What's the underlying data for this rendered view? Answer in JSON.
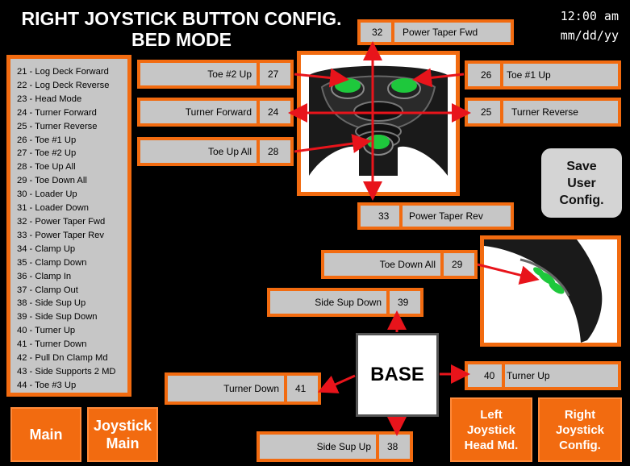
{
  "header": {
    "title_line1": "RIGHT JOYSTICK BUTTON CONFIG.",
    "title_line2": "BED MODE",
    "time": "12:00 am",
    "date": "mm/dd/yy"
  },
  "legend": [
    "21 - Log Deck Forward",
    "22 - Log Deck Reverse",
    "23 - Head Mode",
    "24 - Turner Forward",
    "25 - Turner Reverse",
    "26 - Toe #1 Up",
    "27 - Toe #2 Up",
    "28 - Toe Up All",
    "29 - Toe Down All",
    "30 - Loader Up",
    "31 - Loader Down",
    "32 - Power Taper Fwd",
    "33 - Power Taper Rev",
    "34 - Clamp Up",
    "35 - Clamp Down",
    "36 - Clamp In",
    "37 - Clamp Out",
    "38 - Side Sup Up",
    "39 - Side Sup Down",
    "40 - Turner Up",
    "41 - Turner Down",
    "42 - Pull Dn Clamp Md",
    "43 - Side Supports 2 MD",
    "44 - Toe #3 Up"
  ],
  "fields": {
    "power_taper_fwd": {
      "num": "32",
      "label": "Power Taper Fwd"
    },
    "toe2_up": {
      "num": "27",
      "label": "Toe #2 Up"
    },
    "toe1_up": {
      "num": "26",
      "label": "Toe #1 Up"
    },
    "turner_forward": {
      "num": "24",
      "label": "Turner Forward"
    },
    "turner_reverse": {
      "num": "25",
      "label": "Turner Reverse"
    },
    "toe_up_all": {
      "num": "28",
      "label": "Toe Up All"
    },
    "power_taper_rev": {
      "num": "33",
      "label": "Power Taper Rev"
    },
    "toe_down_all": {
      "num": "29",
      "label": "Toe Down All"
    },
    "side_sup_down": {
      "num": "39",
      "label": "Side Sup Down"
    },
    "turner_up": {
      "num": "40",
      "label": "Turner Up"
    },
    "turner_down": {
      "num": "41",
      "label": "Turner Down"
    },
    "side_sup_up": {
      "num": "38",
      "label": "Side Sup Up"
    }
  },
  "base_label": "BASE",
  "save_button": {
    "line1": "Save",
    "line2": "User",
    "line3": "Config."
  },
  "nav": {
    "main": "Main",
    "joystick_main_1": "Joystick",
    "joystick_main_2": "Main",
    "left_1": "Left",
    "left_2": "Joystick",
    "left_3": "Head Md.",
    "right_1": "Right",
    "right_2": "Joystick",
    "right_3": "Config."
  },
  "colors": {
    "accent_orange": "#f26b10",
    "field_gray": "#c6c6c6",
    "arrow_red": "#e8141b",
    "button_green": "#1ec83c"
  }
}
